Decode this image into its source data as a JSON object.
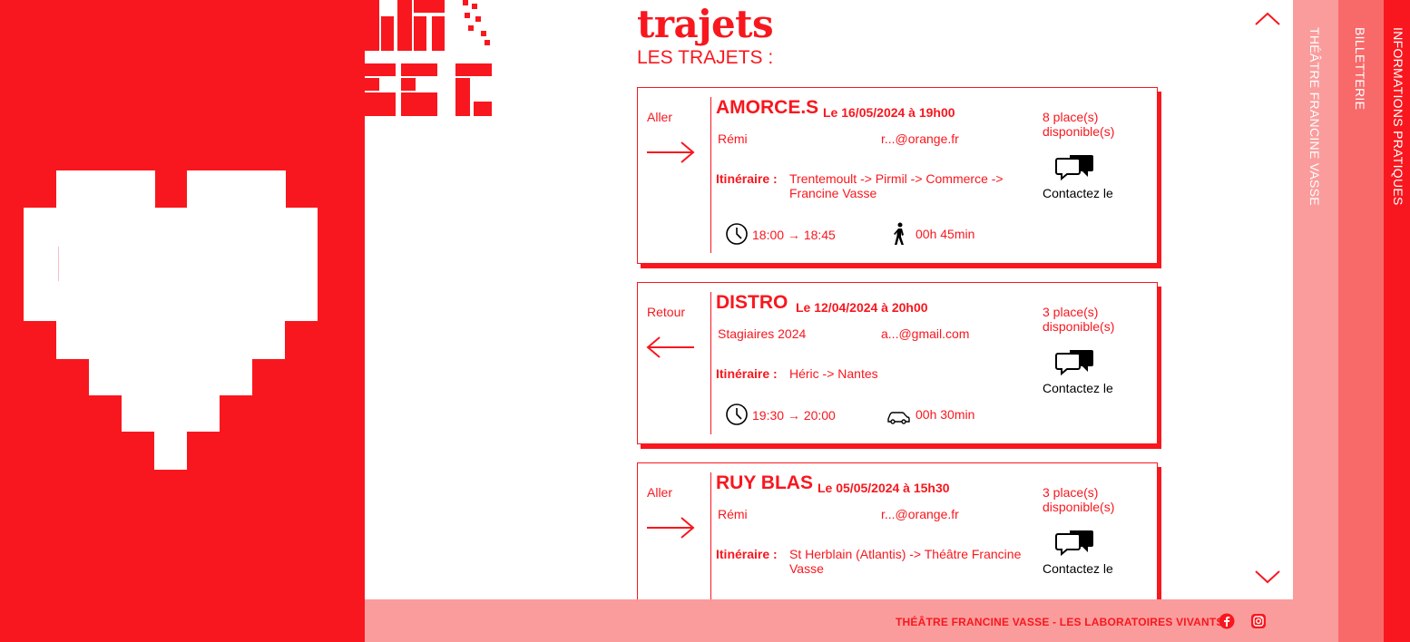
{
  "colors": {
    "brand_red": "#f8171e",
    "footer_pink": "#fb9c9c",
    "tab_theatre": "#fb9c9c",
    "tab_billetterie": "#f86a6a",
    "tab_infos": "#f8171e"
  },
  "header": {
    "title": "trajets",
    "section_title": "LES TRAJETS :"
  },
  "trips": [
    {
      "direction": "Aller",
      "show": "AMORCE.S",
      "date": "Le 16/05/2024 à 19h00",
      "driver": "Rémi",
      "email": "r...@orange.fr",
      "route_label": "Itinéraire :",
      "route": "Trentemoult -> Pirmil -> Commerce -> Francine Vasse",
      "places": "8 place(s) disponible(s)",
      "contact": "Contactez le",
      "time": "18:00 → 18:45",
      "mode": "walk-icon",
      "duration": "00h 45min"
    },
    {
      "direction": "Retour",
      "show": "DISTRO",
      "date": "Le 12/04/2024 à 20h00",
      "driver": "Stagiaires 2024",
      "email": "a...@gmail.com",
      "route_label": "Itinéraire :",
      "route": "Héric -> Nantes",
      "places": "3 place(s) disponible(s)",
      "contact": "Contactez le",
      "time": "19:30 → 20:00",
      "mode": "car-icon",
      "duration": "00h 30min"
    },
    {
      "direction": "Aller",
      "show": "RUY BLAS",
      "date": "Le 05/05/2024 à 15h30",
      "driver": "Rémi",
      "email": "r...@orange.fr",
      "route_label": "Itinéraire :",
      "route": "St Herblain (Atlantis) -> Théâtre Francine Vasse",
      "places": "3 place(s) disponible(s)",
      "contact": "Contactez le"
    }
  ],
  "footer": {
    "text": "THÉÂTRE FRANCINE VASSE - LES LABORATOIRES VIVANTS",
    "icons": [
      "facebook-icon",
      "instagram-icon"
    ]
  },
  "side_tabs": [
    {
      "label": "THÉÂTRE FRANCINE VASSE"
    },
    {
      "label": "BILLETTERIE"
    },
    {
      "label": "INFORMATIONS PRATIQUES"
    }
  ]
}
